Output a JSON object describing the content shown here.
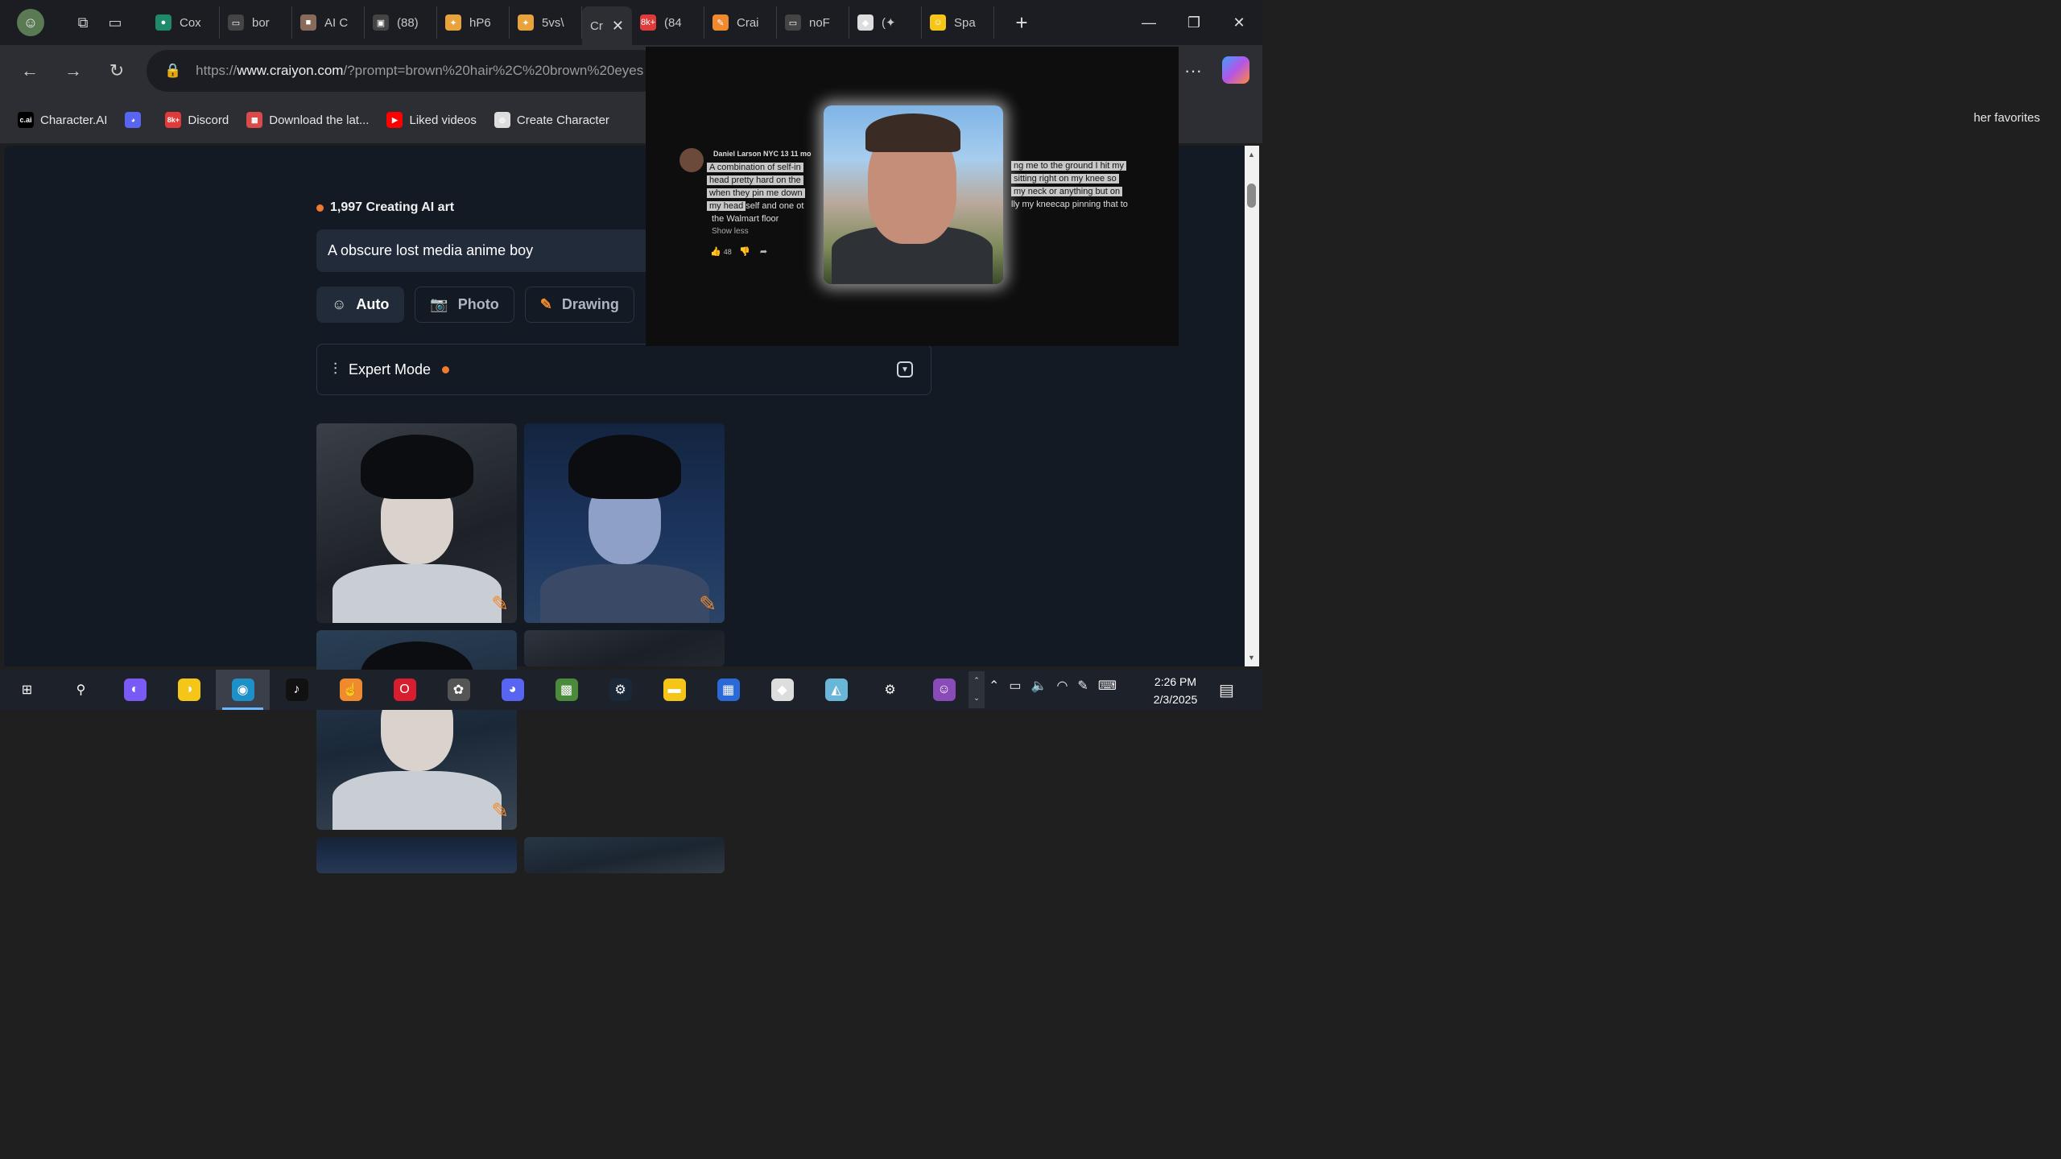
{
  "tabs": [
    {
      "label": "Cox",
      "color": "#1f8a6a",
      "glyph": "●"
    },
    {
      "label": "bor",
      "color": "#444",
      "glyph": "▭"
    },
    {
      "label": "AI C",
      "color": "#8a6a5a",
      "glyph": "■"
    },
    {
      "label": "(88)",
      "color": "#444",
      "glyph": "▣"
    },
    {
      "label": "hP6",
      "color": "#e8a33a",
      "glyph": "✦"
    },
    {
      "label": "5vs\\",
      "color": "#e8a33a",
      "glyph": "✦"
    },
    {
      "label": "Cr",
      "color": "#2c2e33",
      "glyph": ""
    },
    {
      "label": "(84",
      "color": "#e03a3a",
      "glyph": "8k+"
    },
    {
      "label": "Crai",
      "color": "#f08a2e",
      "glyph": "✎"
    },
    {
      "label": "noF",
      "color": "#444",
      "glyph": "▭"
    },
    {
      "label": "(✦",
      "color": "#ddd",
      "glyph": "◆"
    },
    {
      "label": "Spa",
      "color": "#f5c518",
      "glyph": "☺"
    }
  ],
  "browser": {
    "url_prefix": "https://",
    "url_domain": "www.craiyon.com",
    "url_rest": "/?prompt=brown%20hair%2C%20brown%20eyes",
    "more": "···"
  },
  "bookmarks": [
    {
      "label": "Character.AI",
      "color": "#000",
      "glyph": "c.ai"
    },
    {
      "label": "",
      "color": "#5865f2",
      "glyph": "◕"
    },
    {
      "label": "Discord",
      "color": "#e03a3a",
      "glyph": "8k+"
    },
    {
      "label": "Download the lat...",
      "color": "#d94a4a",
      "glyph": "▦"
    },
    {
      "label": "Liked videos",
      "color": "#ff0000",
      "glyph": "▶"
    },
    {
      "label": "Create Character",
      "color": "#ddd",
      "glyph": "◎"
    }
  ],
  "other_favorites": "her favorites",
  "page": {
    "status_count": "1,997 Creating AI art",
    "prompt_text": "A obscure lost media anime boy",
    "modes": [
      {
        "label": "Auto",
        "glyph": "☺",
        "selected": true
      },
      {
        "label": "Photo",
        "glyph": "📷",
        "selected": false
      },
      {
        "label": "Drawing",
        "glyph": "✎",
        "selected": false
      }
    ],
    "expert_mode": "Expert Mode",
    "images": [
      {
        "bg": "linear-gradient(160deg,#3a3f48,#1e2228 60%,#2a2d33)"
      },
      {
        "bg": "linear-gradient(180deg,#13243f,#1d3660 60%,#2a4466)"
      },
      {
        "bg": "linear-gradient(170deg,#2a3f55,#1a2838 55%,#3a4654)"
      }
    ]
  },
  "pip": {
    "author": "Daniel Larson NYC 13  11 mo",
    "lines_left": [
      "A combination of self-in",
      "head pretty hard on the",
      "when they pin me down",
      "my head"
    ],
    "line_left_tail": "self and one ot",
    "line_walmart": "the Walmart floor",
    "show_less": "Show less",
    "likes": "48",
    "lines_right": [
      "ng me to the ground I hit my",
      "sitting right on my knee so",
      "my neck or anything but on"
    ],
    "line_right_tail": "lly my kneecap pinning that to"
  },
  "taskbar": {
    "time": "2:26 PM",
    "date": "2/3/2025",
    "apps": [
      {
        "name": "windows-start",
        "glyph": "⊞",
        "color": "transparent"
      },
      {
        "name": "search",
        "glyph": "⚲",
        "color": "transparent"
      },
      {
        "name": "copilot",
        "glyph": "◐",
        "color": "#7a5af5"
      },
      {
        "name": "chrome-canary",
        "glyph": "◑",
        "color": "#f5c518"
      },
      {
        "name": "edge",
        "glyph": "◉",
        "color": "#1e90c8"
      },
      {
        "name": "tiktok",
        "glyph": "♪",
        "color": "#111"
      },
      {
        "name": "app-orange",
        "glyph": "☝",
        "color": "#f08a2e"
      },
      {
        "name": "opera",
        "glyph": "O",
        "color": "#d81e2e"
      },
      {
        "name": "paint",
        "glyph": "✿",
        "color": "#555"
      },
      {
        "name": "discord",
        "glyph": "◕",
        "color": "#5865f2"
      },
      {
        "name": "minecraft",
        "glyph": "▩",
        "color": "#4a8a3a"
      },
      {
        "name": "steam",
        "glyph": "⚙",
        "color": "#1b2838"
      },
      {
        "name": "file-explorer",
        "glyph": "▬",
        "color": "#f5c518"
      },
      {
        "name": "ms-store",
        "glyph": "▦",
        "color": "#2a6ad8"
      },
      {
        "name": "roblox",
        "glyph": "◆",
        "color": "#ddd"
      },
      {
        "name": "app-blue",
        "glyph": "◭",
        "color": "#6ab6d8"
      },
      {
        "name": "settings",
        "glyph": "⚙",
        "color": "transparent"
      },
      {
        "name": "anime-app",
        "glyph": "☺",
        "color": "#8a4ab8"
      }
    ]
  }
}
